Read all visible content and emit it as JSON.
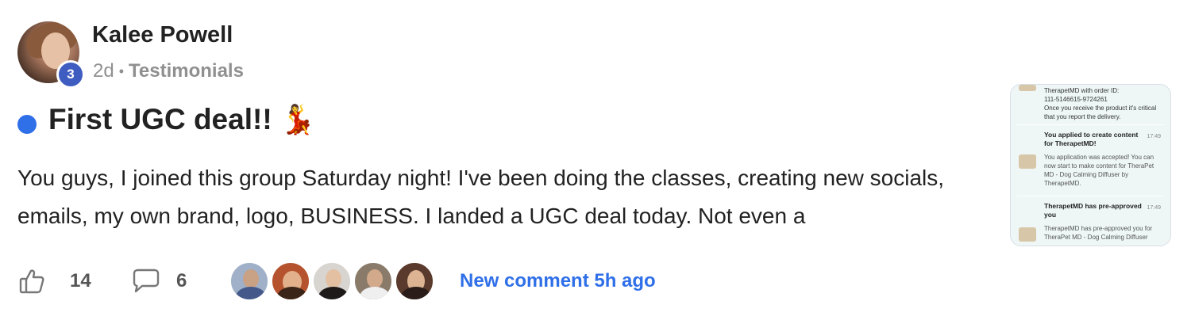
{
  "author": {
    "name": "Kalee Powell",
    "level": "3",
    "time_ago": "2d",
    "separator": "•",
    "category": "Testimonials"
  },
  "post": {
    "title": "First UGC deal!!",
    "title_emoji": "💃",
    "body": "You guys, I joined this group Saturday night! I've been doing the classes, creating new socials, emails, my own brand, logo, BUSINESS. I landed a UGC deal today. Not even a"
  },
  "footer": {
    "like_count": "14",
    "comment_count": "6",
    "new_comment": "New comment 5h ago"
  },
  "thumbnail": {
    "msg1_line1": "TherapetMD with order ID:",
    "msg1_line2": "111-5146615-9724261",
    "msg1_line3": "Once you receive the product it's critical",
    "msg1_line4": "that you report the delivery.",
    "msg2_title_1": "You applied to create content",
    "msg2_title_2": "for TherapetMD!",
    "msg2_time": "17:49",
    "msg2_body_1": "You application was accepted! You can",
    "msg2_body_2": "now start to make content for TheraPet",
    "msg2_body_3": "MD - Dog Calming Diffuser by",
    "msg2_body_4": "TherapetMD.",
    "msg3_title_1": "TherapetMD has pre-approved",
    "msg3_title_2": "you",
    "msg3_time": "17:49",
    "msg3_body_1": "TherapetMD has pre-approved you for",
    "msg3_body_2": "TheraPet MD - Dog Calming Diffuser"
  },
  "colors": {
    "accent": "#2f6fe8",
    "badge": "#3f5cc0",
    "muted": "#909090"
  }
}
